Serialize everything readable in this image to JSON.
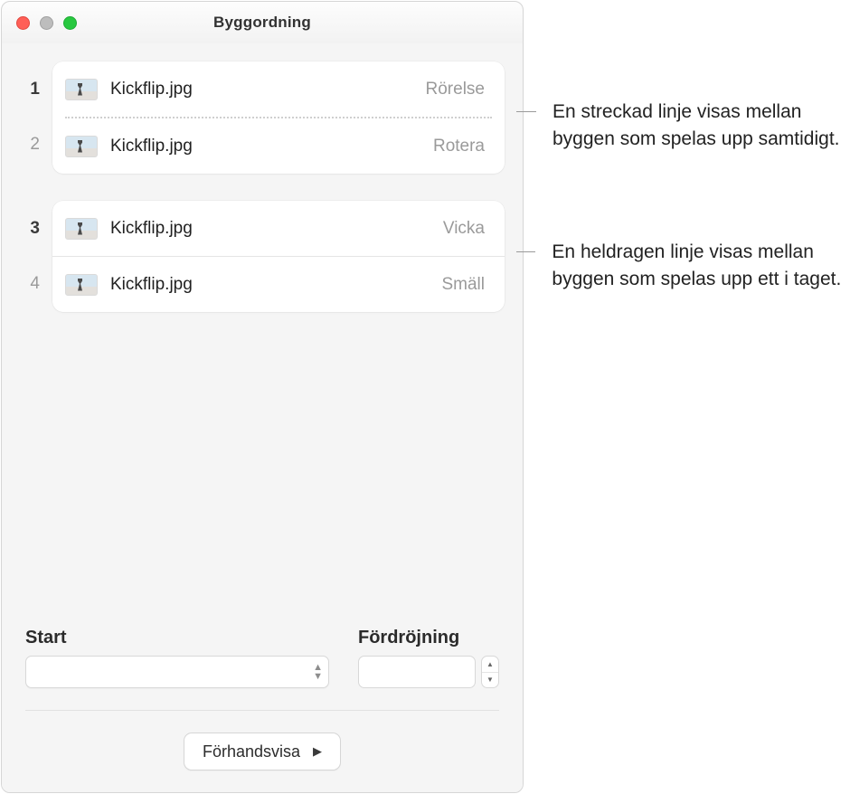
{
  "titlebar": {
    "close_icon": "close-icon",
    "min_icon": "minimize-icon",
    "zoom_icon": "zoom-icon",
    "title": "Byggordning"
  },
  "builds": {
    "group_a": [
      {
        "num": "1",
        "num_bold": true,
        "file": "Kickflip.jpg",
        "effect": "Rörelse"
      },
      {
        "num": "2",
        "num_bold": false,
        "file": "Kickflip.jpg",
        "effect": "Rotera"
      }
    ],
    "group_b": [
      {
        "num": "3",
        "num_bold": true,
        "file": "Kickflip.jpg",
        "effect": "Vicka"
      },
      {
        "num": "4",
        "num_bold": false,
        "file": "Kickflip.jpg",
        "effect": "Smäll"
      }
    ]
  },
  "form": {
    "start_label": "Start",
    "delay_label": "Fördröjning",
    "start_value": "",
    "delay_value": ""
  },
  "preview": {
    "label": "Förhandsvisa"
  },
  "callouts": {
    "c1": "En streckad linje visas mellan byggen som spelas upp samtidigt.",
    "c2": "En heldragen linje visas mellan byggen som spelas upp ett i taget."
  }
}
